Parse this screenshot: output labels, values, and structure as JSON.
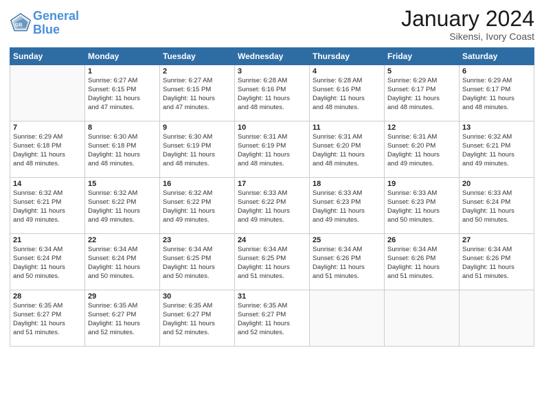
{
  "header": {
    "logo_line1": "General",
    "logo_line2": "Blue",
    "month_title": "January 2024",
    "location": "Sikensi, Ivory Coast"
  },
  "days_of_week": [
    "Sunday",
    "Monday",
    "Tuesday",
    "Wednesday",
    "Thursday",
    "Friday",
    "Saturday"
  ],
  "weeks": [
    [
      {
        "day": "",
        "info": ""
      },
      {
        "day": "1",
        "info": "Sunrise: 6:27 AM\nSunset: 6:15 PM\nDaylight: 11 hours\nand 47 minutes."
      },
      {
        "day": "2",
        "info": "Sunrise: 6:27 AM\nSunset: 6:15 PM\nDaylight: 11 hours\nand 47 minutes."
      },
      {
        "day": "3",
        "info": "Sunrise: 6:28 AM\nSunset: 6:16 PM\nDaylight: 11 hours\nand 48 minutes."
      },
      {
        "day": "4",
        "info": "Sunrise: 6:28 AM\nSunset: 6:16 PM\nDaylight: 11 hours\nand 48 minutes."
      },
      {
        "day": "5",
        "info": "Sunrise: 6:29 AM\nSunset: 6:17 PM\nDaylight: 11 hours\nand 48 minutes."
      },
      {
        "day": "6",
        "info": "Sunrise: 6:29 AM\nSunset: 6:17 PM\nDaylight: 11 hours\nand 48 minutes."
      }
    ],
    [
      {
        "day": "7",
        "info": "Sunrise: 6:29 AM\nSunset: 6:18 PM\nDaylight: 11 hours\nand 48 minutes."
      },
      {
        "day": "8",
        "info": "Sunrise: 6:30 AM\nSunset: 6:18 PM\nDaylight: 11 hours\nand 48 minutes."
      },
      {
        "day": "9",
        "info": "Sunrise: 6:30 AM\nSunset: 6:19 PM\nDaylight: 11 hours\nand 48 minutes."
      },
      {
        "day": "10",
        "info": "Sunrise: 6:31 AM\nSunset: 6:19 PM\nDaylight: 11 hours\nand 48 minutes."
      },
      {
        "day": "11",
        "info": "Sunrise: 6:31 AM\nSunset: 6:20 PM\nDaylight: 11 hours\nand 48 minutes."
      },
      {
        "day": "12",
        "info": "Sunrise: 6:31 AM\nSunset: 6:20 PM\nDaylight: 11 hours\nand 49 minutes."
      },
      {
        "day": "13",
        "info": "Sunrise: 6:32 AM\nSunset: 6:21 PM\nDaylight: 11 hours\nand 49 minutes."
      }
    ],
    [
      {
        "day": "14",
        "info": "Sunrise: 6:32 AM\nSunset: 6:21 PM\nDaylight: 11 hours\nand 49 minutes."
      },
      {
        "day": "15",
        "info": "Sunrise: 6:32 AM\nSunset: 6:22 PM\nDaylight: 11 hours\nand 49 minutes."
      },
      {
        "day": "16",
        "info": "Sunrise: 6:32 AM\nSunset: 6:22 PM\nDaylight: 11 hours\nand 49 minutes."
      },
      {
        "day": "17",
        "info": "Sunrise: 6:33 AM\nSunset: 6:22 PM\nDaylight: 11 hours\nand 49 minutes."
      },
      {
        "day": "18",
        "info": "Sunrise: 6:33 AM\nSunset: 6:23 PM\nDaylight: 11 hours\nand 49 minutes."
      },
      {
        "day": "19",
        "info": "Sunrise: 6:33 AM\nSunset: 6:23 PM\nDaylight: 11 hours\nand 50 minutes."
      },
      {
        "day": "20",
        "info": "Sunrise: 6:33 AM\nSunset: 6:24 PM\nDaylight: 11 hours\nand 50 minutes."
      }
    ],
    [
      {
        "day": "21",
        "info": "Sunrise: 6:34 AM\nSunset: 6:24 PM\nDaylight: 11 hours\nand 50 minutes."
      },
      {
        "day": "22",
        "info": "Sunrise: 6:34 AM\nSunset: 6:24 PM\nDaylight: 11 hours\nand 50 minutes."
      },
      {
        "day": "23",
        "info": "Sunrise: 6:34 AM\nSunset: 6:25 PM\nDaylight: 11 hours\nand 50 minutes."
      },
      {
        "day": "24",
        "info": "Sunrise: 6:34 AM\nSunset: 6:25 PM\nDaylight: 11 hours\nand 51 minutes."
      },
      {
        "day": "25",
        "info": "Sunrise: 6:34 AM\nSunset: 6:26 PM\nDaylight: 11 hours\nand 51 minutes."
      },
      {
        "day": "26",
        "info": "Sunrise: 6:34 AM\nSunset: 6:26 PM\nDaylight: 11 hours\nand 51 minutes."
      },
      {
        "day": "27",
        "info": "Sunrise: 6:34 AM\nSunset: 6:26 PM\nDaylight: 11 hours\nand 51 minutes."
      }
    ],
    [
      {
        "day": "28",
        "info": "Sunrise: 6:35 AM\nSunset: 6:27 PM\nDaylight: 11 hours\nand 51 minutes."
      },
      {
        "day": "29",
        "info": "Sunrise: 6:35 AM\nSunset: 6:27 PM\nDaylight: 11 hours\nand 52 minutes."
      },
      {
        "day": "30",
        "info": "Sunrise: 6:35 AM\nSunset: 6:27 PM\nDaylight: 11 hours\nand 52 minutes."
      },
      {
        "day": "31",
        "info": "Sunrise: 6:35 AM\nSunset: 6:27 PM\nDaylight: 11 hours\nand 52 minutes."
      },
      {
        "day": "",
        "info": ""
      },
      {
        "day": "",
        "info": ""
      },
      {
        "day": "",
        "info": ""
      }
    ]
  ]
}
